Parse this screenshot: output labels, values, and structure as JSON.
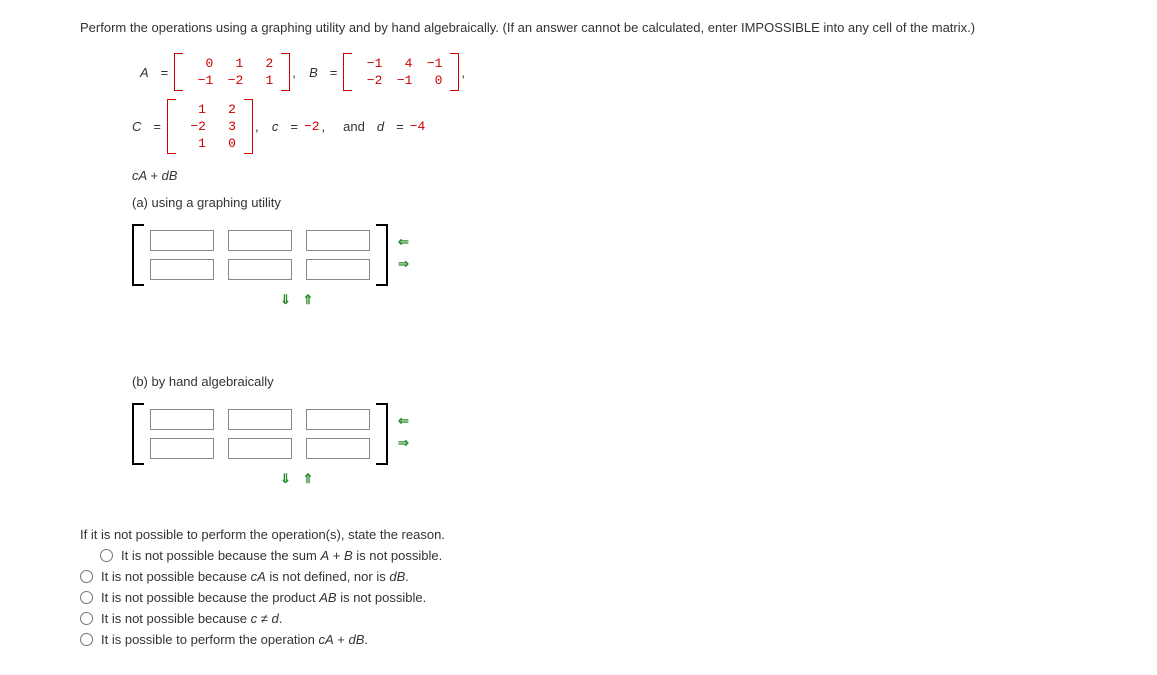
{
  "instruction": "Perform the operations using a graphing utility and by hand algebraically. (If an answer cannot be calculated, enter IMPOSSIBLE into any cell of the matrix.)",
  "labels": {
    "A": "A",
    "B": "B",
    "C": "C",
    "c": "c",
    "d": "d",
    "eq": "=",
    "comma": ",",
    "and": "and"
  },
  "matrices": {
    "A": [
      [
        "0",
        "1",
        "2"
      ],
      [
        "−1",
        "−2",
        "1"
      ]
    ],
    "B": [
      [
        "−1",
        "4",
        "−1"
      ],
      [
        "−2",
        "−1",
        "0"
      ]
    ],
    "C": [
      [
        "1",
        "2"
      ],
      [
        "−2",
        "3"
      ],
      [
        "1",
        "0"
      ]
    ]
  },
  "scalars": {
    "c": "−2",
    "d": "−4"
  },
  "expression": "cA + dB",
  "part_a": "(a) using a graphing utility",
  "part_b": "(b) by hand algebraically",
  "arrows": {
    "left": "⇐",
    "right": "⇒",
    "down": "⇓",
    "up": "⇑",
    "ud": "⇓ ⇑"
  },
  "reason_prompt": "If it is not possible to perform the operation(s), state the reason.",
  "options": [
    "It is not possible because the sum A + B is not possible.",
    "It is not possible because cA is not defined, nor is dB.",
    "It is not possible because the product AB is not possible.",
    "It is not possible because c ≠ d.",
    "It is possible to perform the operation cA + dB."
  ]
}
